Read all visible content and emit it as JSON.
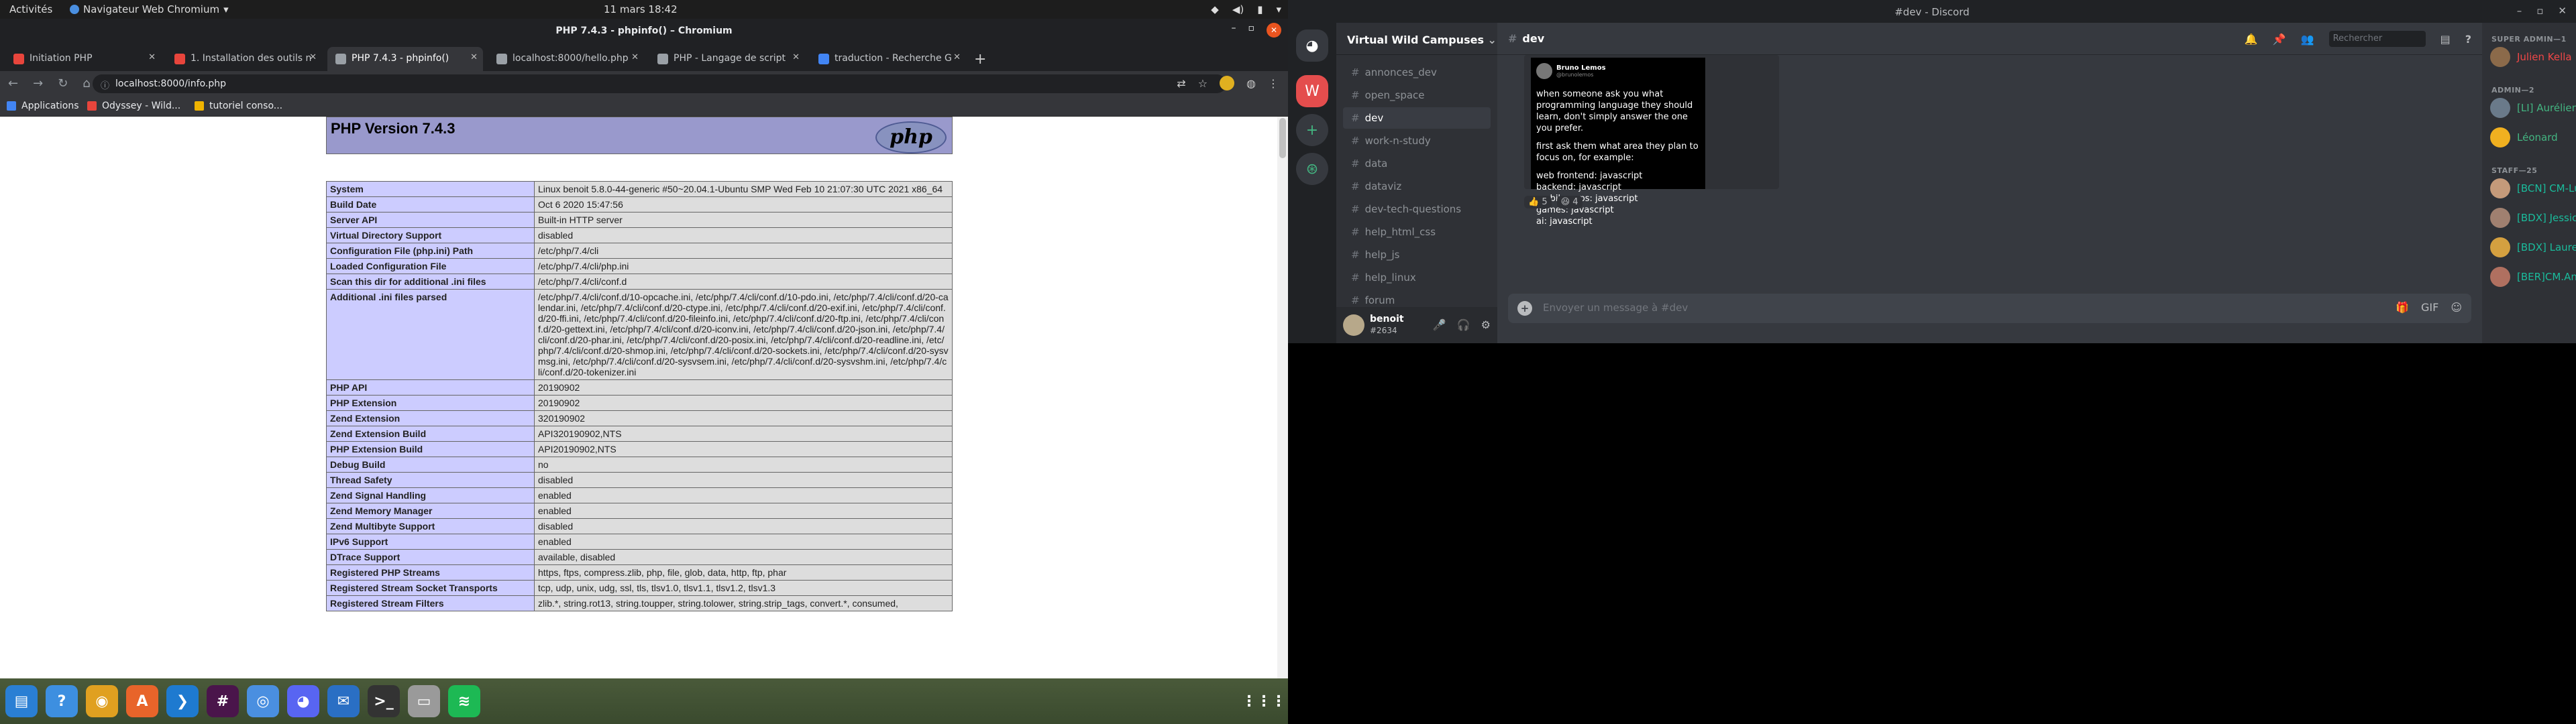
{
  "topbar": {
    "activities": "Activités",
    "app_menu": "Navigateur Web Chromium",
    "clock": "11 mars  18:42"
  },
  "chromium": {
    "window_title": "PHP 7.4.3 - phpinfo() – Chromium",
    "tabs": [
      {
        "label": "Initiation PHP",
        "favicon_color": "#e8453c"
      },
      {
        "label": "1. Installation des outils n",
        "favicon_color": "#e8453c"
      },
      {
        "label": "PHP 7.4.3 - phpinfo()",
        "favicon_color": "#9aa0a6"
      },
      {
        "label": "localhost:8000/hello.php",
        "favicon_color": "#9aa0a6"
      },
      {
        "label": "PHP - Langage de script",
        "favicon_color": "#9aa0a6"
      },
      {
        "label": "traduction - Recherche G",
        "favicon_color": "#4285f4"
      }
    ],
    "url": "localhost:8000/info.php",
    "bookmarks": [
      {
        "label": "Applications",
        "color": "#4285f4"
      },
      {
        "label": "Odyssey - Wild...",
        "color": "#e8453c"
      },
      {
        "label": "tutoriel conso...",
        "color": "#f0b400"
      }
    ]
  },
  "phpinfo": {
    "heading": "PHP Version 7.4.3",
    "logo_text": "php",
    "rows": [
      {
        "k": "System",
        "v": "Linux benoit 5.8.0-44-generic #50~20.04.1-Ubuntu SMP Wed Feb 10 21:07:30 UTC 2021 x86_64"
      },
      {
        "k": "Build Date",
        "v": "Oct 6 2020 15:47:56"
      },
      {
        "k": "Server API",
        "v": "Built-in HTTP server"
      },
      {
        "k": "Virtual Directory Support",
        "v": "disabled"
      },
      {
        "k": "Configuration File (php.ini) Path",
        "v": "/etc/php/7.4/cli"
      },
      {
        "k": "Loaded Configuration File",
        "v": "/etc/php/7.4/cli/php.ini"
      },
      {
        "k": "Scan this dir for additional .ini files",
        "v": "/etc/php/7.4/cli/conf.d"
      },
      {
        "k": "Additional .ini files parsed",
        "v": "/etc/php/7.4/cli/conf.d/10-opcache.ini, /etc/php/7.4/cli/conf.d/10-pdo.ini, /etc/php/7.4/cli/conf.d/20-calendar.ini, /etc/php/7.4/cli/conf.d/20-ctype.ini, /etc/php/7.4/cli/conf.d/20-exif.ini, /etc/php/7.4/cli/conf.d/20-ffi.ini, /etc/php/7.4/cli/conf.d/20-fileinfo.ini, /etc/php/7.4/cli/conf.d/20-ftp.ini, /etc/php/7.4/cli/conf.d/20-gettext.ini, /etc/php/7.4/cli/conf.d/20-iconv.ini, /etc/php/7.4/cli/conf.d/20-json.ini, /etc/php/7.4/cli/conf.d/20-phar.ini, /etc/php/7.4/cli/conf.d/20-posix.ini, /etc/php/7.4/cli/conf.d/20-readline.ini, /etc/php/7.4/cli/conf.d/20-shmop.ini, /etc/php/7.4/cli/conf.d/20-sockets.ini, /etc/php/7.4/cli/conf.d/20-sysvmsg.ini, /etc/php/7.4/cli/conf.d/20-sysvsem.ini, /etc/php/7.4/cli/conf.d/20-sysvshm.ini, /etc/php/7.4/cli/conf.d/20-tokenizer.ini"
      },
      {
        "k": "PHP API",
        "v": "20190902"
      },
      {
        "k": "PHP Extension",
        "v": "20190902"
      },
      {
        "k": "Zend Extension",
        "v": "320190902"
      },
      {
        "k": "Zend Extension Build",
        "v": "API320190902,NTS"
      },
      {
        "k": "PHP Extension Build",
        "v": "API20190902,NTS"
      },
      {
        "k": "Debug Build",
        "v": "no"
      },
      {
        "k": "Thread Safety",
        "v": "disabled"
      },
      {
        "k": "Zend Signal Handling",
        "v": "enabled"
      },
      {
        "k": "Zend Memory Manager",
        "v": "enabled"
      },
      {
        "k": "Zend Multibyte Support",
        "v": "disabled"
      },
      {
        "k": "IPv6 Support",
        "v": "enabled"
      },
      {
        "k": "DTrace Support",
        "v": "available, disabled"
      },
      {
        "k": "Registered PHP Streams",
        "v": "https, ftps, compress.zlib, php, file, glob, data, http, ftp, phar"
      },
      {
        "k": "Registered Stream Socket Transports",
        "v": "tcp, udp, unix, udg, ssl, tls, tlsv1.0, tlsv1.1, tlsv1.2, tlsv1.3"
      },
      {
        "k": "Registered Stream Filters",
        "v": "zlib.*, string.rot13, string.toupper, string.tolower, string.strip_tags, convert.*, consumed,"
      }
    ]
  },
  "dock": [
    {
      "name": "files-docs-icon",
      "color": "#2a7fd4",
      "glyph": "▤"
    },
    {
      "name": "help-icon",
      "color": "#3d8fe0",
      "glyph": "?"
    },
    {
      "name": "rhythmbox-icon",
      "color": "#e0a020",
      "glyph": "◉"
    },
    {
      "name": "software-icon",
      "color": "#e8642a",
      "glyph": "A"
    },
    {
      "name": "vscode-icon",
      "color": "#1e7ad0",
      "glyph": "❯"
    },
    {
      "name": "slack-icon",
      "color": "#4a154b",
      "glyph": "#"
    },
    {
      "name": "chromium-icon",
      "color": "#4a8fe0",
      "glyph": "◎"
    },
    {
      "name": "discord-dock-icon",
      "color": "#5865f2",
      "glyph": "◕"
    },
    {
      "name": "thunderbird-icon",
      "color": "#2a6fc4",
      "glyph": "✉"
    },
    {
      "name": "terminal-icon",
      "color": "#333333",
      "glyph": ">_"
    },
    {
      "name": "files-icon",
      "color": "#9a9a9a",
      "glyph": "▭"
    },
    {
      "name": "spotify-icon",
      "color": "#1db954",
      "glyph": "≋"
    }
  ],
  "discord": {
    "window_title": "#dev - Discord",
    "server_name": "Virtual Wild Campuses",
    "channels": [
      {
        "label": "annonces_dev",
        "selected": false
      },
      {
        "label": "open_space",
        "selected": false
      },
      {
        "label": "dev",
        "selected": true
      },
      {
        "label": "work-n-study",
        "selected": false
      },
      {
        "label": "data",
        "selected": false
      },
      {
        "label": "dataviz",
        "selected": false
      },
      {
        "label": "dev-tech-questions",
        "selected": false
      },
      {
        "label": "help_html_css",
        "selected": false
      },
      {
        "label": "help_js",
        "selected": false
      },
      {
        "label": "help_linux",
        "selected": false
      },
      {
        "label": "forum",
        "selected": false
      }
    ],
    "user": {
      "name": "benoit",
      "tag": "#2634"
    },
    "channel_title": "dev",
    "search_placeholder": "Rechercher",
    "message_placeholder": "Envoyer un message à #dev",
    "tweet": {
      "author": "Bruno Lemos",
      "handle": "@brunolemos",
      "p1": "when someone ask you what programming language they should learn, don't simply answer the one you prefer.",
      "p2": "first ask them what area they plan to focus on, for example:",
      "lines": [
        "web frontend: javascript",
        "backend: javascript",
        "mobile apps: javascript",
        "games: javascript",
        "ai: javascript"
      ]
    },
    "reactions": [
      "👍 5",
      "😆 4"
    ],
    "member_groups": [
      {
        "title": "SUPER ADMIN—1",
        "members": [
          {
            "name": "Julien Kella ❗ ◉",
            "color": "#f04747",
            "avatar": "#8b6a4a"
          }
        ]
      },
      {
        "title": "ADMIN—2",
        "members": [
          {
            "name": "[LI] Aurélien Barbier",
            "color": "#43b581",
            "avatar": "#6a7a8a"
          },
          {
            "name": "Léonard",
            "color": "#43b581",
            "avatar": "#f0b020"
          }
        ]
      },
      {
        "title": "STAFF—25",
        "members": [
          {
            "name": "[BCN] CM-Luz Cortázar",
            "color": "#1abc9c",
            "avatar": "#c49a7a"
          },
          {
            "name": "[BDX] Jessica - Camp...",
            "color": "#1abc9c",
            "avatar": "#a08070"
          },
          {
            "name": "[BDX] Laurent Andria...",
            "color": "#1abc9c",
            "avatar": "#d4a040"
          },
          {
            "name": "[BER]CM.Annemarie ...",
            "color": "#1abc9c",
            "avatar": "#b07060"
          }
        ]
      }
    ]
  }
}
